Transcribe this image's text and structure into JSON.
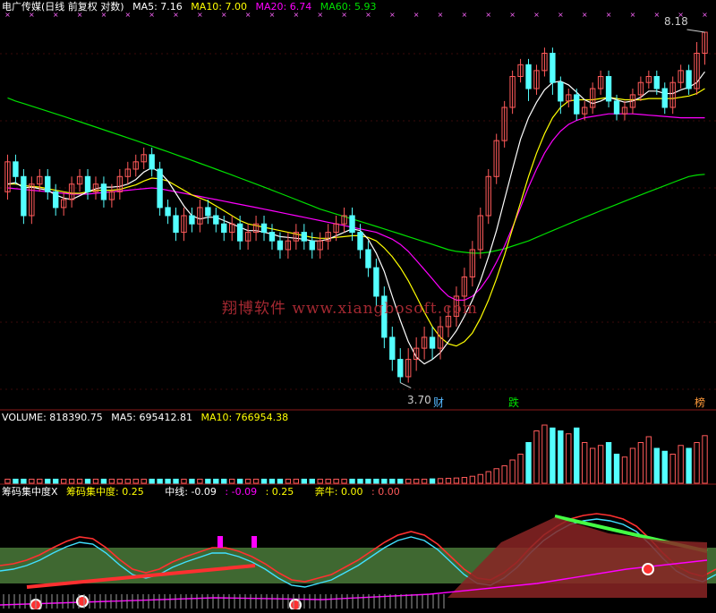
{
  "price_header": {
    "title": "电广传媒(日线 前复权 对数)",
    "ma5": "MA5: 7.16",
    "ma10": "MA10: 7.00",
    "ma20": "MA20: 6.74",
    "ma60": "MA60: 5.93"
  },
  "volume_header": {
    "title": "VOLUME: 818390.75",
    "ma5": "MA5: 695412.81",
    "ma10": "MA10: 766954.38"
  },
  "indicator_header": {
    "name": "筹码集中度X",
    "value": "筹码集中度: 0.25",
    "mid_label": "中线: -0.09",
    "mid_v2": ": -0.09",
    "mid_v3": ": 0.25",
    "bull": "奔牛: 0.00",
    "bull_v2": ": 0.00"
  },
  "watermark": "翔博软件 www.xiangbosoft.com",
  "price_marks": {
    "high": "8.18",
    "low": "3.70"
  },
  "event_labels": {
    "cai": "财",
    "die": "跌",
    "bang": "榜"
  },
  "colors": {
    "up": "#ff5a5a",
    "down": "#54ffff",
    "ma5": "#ffffff",
    "ma10": "#ffff00",
    "ma20": "#ff00ff",
    "ma60": "#00e000",
    "green_area": "#4a7a3a",
    "dark_red_area": "#8a2525"
  },
  "chart_data": [
    {
      "type": "candlestick",
      "title": "电广传媒(日线 前复权 对数)",
      "ylim": [
        3.55,
        8.45
      ],
      "log_scale": true,
      "annotated_high": 8.18,
      "annotated_low": 3.7,
      "candles": [
        [
          5.7,
          6.1,
          6.2,
          5.6
        ],
        [
          6.1,
          5.9,
          6.2,
          5.8
        ],
        [
          5.9,
          5.4,
          6.0,
          5.3
        ],
        [
          5.4,
          5.8,
          5.9,
          5.3
        ],
        [
          5.8,
          5.9,
          6.0,
          5.7
        ],
        [
          5.9,
          5.7,
          6.0,
          5.6
        ],
        [
          5.7,
          5.5,
          5.8,
          5.4
        ],
        [
          5.5,
          5.6,
          5.7,
          5.4
        ],
        [
          5.6,
          5.8,
          5.9,
          5.5
        ],
        [
          5.8,
          5.9,
          6.0,
          5.7
        ],
        [
          5.9,
          5.7,
          6.0,
          5.6
        ],
        [
          5.7,
          5.8,
          5.9,
          5.6
        ],
        [
          5.8,
          5.6,
          5.9,
          5.5
        ],
        [
          5.6,
          5.7,
          5.8,
          5.5
        ],
        [
          5.7,
          5.9,
          6.0,
          5.6
        ],
        [
          5.9,
          6.0,
          6.1,
          5.8
        ],
        [
          6.0,
          6.1,
          6.2,
          5.9
        ],
        [
          6.1,
          6.2,
          6.3,
          6.0
        ],
        [
          6.2,
          6.0,
          6.3,
          5.9
        ],
        [
          6.0,
          5.5,
          6.1,
          5.4
        ],
        [
          5.5,
          5.4,
          5.6,
          5.3
        ],
        [
          5.4,
          5.2,
          5.5,
          5.1
        ],
        [
          5.2,
          5.4,
          5.5,
          5.1
        ],
        [
          5.4,
          5.3,
          5.5,
          5.2
        ],
        [
          5.3,
          5.5,
          5.6,
          5.2
        ],
        [
          5.5,
          5.4,
          5.6,
          5.3
        ],
        [
          5.4,
          5.3,
          5.5,
          5.2
        ],
        [
          5.3,
          5.2,
          5.4,
          5.1
        ],
        [
          5.2,
          5.3,
          5.4,
          5.1
        ],
        [
          5.3,
          5.1,
          5.4,
          5.0
        ],
        [
          5.1,
          5.2,
          5.3,
          5.0
        ],
        [
          5.2,
          5.3,
          5.4,
          5.1
        ],
        [
          5.3,
          5.2,
          5.4,
          5.1
        ],
        [
          5.2,
          5.1,
          5.3,
          5.0
        ],
        [
          5.1,
          5.0,
          5.2,
          4.9
        ],
        [
          5.0,
          5.1,
          5.2,
          4.9
        ],
        [
          5.1,
          5.2,
          5.3,
          5.0
        ],
        [
          5.2,
          5.1,
          5.3,
          5.0
        ],
        [
          5.1,
          5.0,
          5.2,
          4.9
        ],
        [
          5.0,
          5.1,
          5.2,
          4.9
        ],
        [
          5.1,
          5.2,
          5.3,
          5.0
        ],
        [
          5.2,
          5.3,
          5.4,
          5.1
        ],
        [
          5.3,
          5.4,
          5.5,
          5.2
        ],
        [
          5.4,
          5.2,
          5.5,
          5.1
        ],
        [
          5.2,
          5.0,
          5.3,
          4.9
        ],
        [
          5.0,
          4.8,
          5.1,
          4.7
        ],
        [
          4.8,
          4.5,
          4.9,
          4.4
        ],
        [
          4.5,
          4.1,
          4.6,
          4.0
        ],
        [
          4.1,
          3.9,
          4.2,
          3.8
        ],
        [
          3.9,
          3.75,
          4.0,
          3.7
        ],
        [
          3.75,
          3.9,
          4.0,
          3.7
        ],
        [
          3.9,
          4.0,
          4.1,
          3.8
        ],
        [
          4.0,
          4.1,
          4.2,
          3.9
        ],
        [
          4.1,
          4.0,
          4.2,
          3.9
        ],
        [
          4.0,
          4.2,
          4.3,
          3.9
        ],
        [
          4.2,
          4.3,
          4.4,
          4.1
        ],
        [
          4.3,
          4.5,
          4.6,
          4.2
        ],
        [
          4.5,
          4.7,
          4.8,
          4.4
        ],
        [
          4.7,
          5.0,
          5.1,
          4.6
        ],
        [
          5.0,
          5.4,
          5.5,
          4.9
        ],
        [
          5.4,
          5.9,
          6.0,
          5.3
        ],
        [
          5.9,
          6.4,
          6.5,
          5.8
        ],
        [
          6.4,
          6.9,
          7.0,
          6.3
        ],
        [
          6.9,
          7.4,
          7.5,
          6.8
        ],
        [
          7.4,
          7.6,
          7.7,
          7.3
        ],
        [
          7.6,
          7.2,
          7.7,
          7.0
        ],
        [
          7.2,
          7.5,
          7.6,
          7.1
        ],
        [
          7.5,
          7.8,
          7.9,
          7.4
        ],
        [
          7.8,
          7.3,
          7.9,
          7.1
        ],
        [
          7.3,
          7.0,
          7.4,
          6.8
        ],
        [
          7.0,
          7.1,
          7.2,
          6.9
        ],
        [
          7.1,
          6.8,
          7.2,
          6.7
        ],
        [
          6.8,
          6.9,
          7.0,
          6.7
        ],
        [
          6.9,
          7.2,
          7.3,
          6.8
        ],
        [
          7.2,
          7.4,
          7.5,
          7.1
        ],
        [
          7.4,
          7.0,
          7.5,
          6.9
        ],
        [
          7.0,
          6.8,
          7.1,
          6.7
        ],
        [
          6.8,
          6.9,
          7.0,
          6.7
        ],
        [
          6.9,
          7.1,
          7.2,
          6.8
        ],
        [
          7.1,
          7.3,
          7.4,
          7.0
        ],
        [
          7.3,
          7.4,
          7.5,
          7.2
        ],
        [
          7.4,
          7.2,
          7.5,
          7.1
        ],
        [
          7.2,
          6.9,
          7.3,
          6.8
        ],
        [
          6.9,
          7.3,
          7.4,
          6.8
        ],
        [
          7.3,
          7.5,
          7.6,
          7.2
        ],
        [
          7.5,
          7.2,
          7.6,
          7.1
        ],
        [
          7.2,
          7.8,
          8.0,
          7.1
        ],
        [
          7.8,
          8.18,
          8.18,
          7.6
        ]
      ],
      "ma5": [
        5.8,
        5.82,
        5.75,
        5.76,
        5.74,
        5.72,
        5.66,
        5.62,
        5.6,
        5.65,
        5.7,
        5.74,
        5.76,
        5.76,
        5.77,
        5.8,
        5.86,
        5.96,
        6.02,
        5.96,
        5.84,
        5.68,
        5.52,
        5.4,
        5.36,
        5.38,
        5.38,
        5.34,
        5.3,
        5.26,
        5.22,
        5.22,
        5.2,
        5.18,
        5.15,
        5.14,
        5.13,
        5.12,
        5.1,
        5.1,
        5.12,
        5.16,
        5.2,
        5.24,
        5.22,
        5.12,
        4.96,
        4.76,
        4.5,
        4.26,
        4.06,
        3.92,
        3.86,
        3.9,
        3.96,
        4.06,
        4.16,
        4.3,
        4.46,
        4.66,
        4.92,
        5.22,
        5.6,
        6.0,
        6.42,
        6.74,
        6.98,
        7.18,
        7.3,
        7.32,
        7.26,
        7.14,
        7.02,
        6.96,
        7.0,
        7.06,
        7.02,
        6.98,
        7.0,
        7.06,
        7.16,
        7.16,
        7.12,
        7.12,
        7.18,
        7.22,
        7.3,
        7.48
      ],
      "ma10": [
        5.8,
        5.8,
        5.78,
        5.77,
        5.76,
        5.74,
        5.72,
        5.7,
        5.68,
        5.68,
        5.7,
        5.72,
        5.72,
        5.72,
        5.73,
        5.76,
        5.79,
        5.84,
        5.88,
        5.87,
        5.84,
        5.78,
        5.72,
        5.66,
        5.62,
        5.58,
        5.52,
        5.46,
        5.4,
        5.34,
        5.3,
        5.28,
        5.26,
        5.24,
        5.22,
        5.2,
        5.18,
        5.16,
        5.14,
        5.13,
        5.13,
        5.14,
        5.15,
        5.16,
        5.16,
        5.14,
        5.1,
        5.02,
        4.92,
        4.8,
        4.66,
        4.5,
        4.34,
        4.2,
        4.1,
        4.04,
        4.02,
        4.06,
        4.14,
        4.28,
        4.46,
        4.68,
        4.94,
        5.24,
        5.56,
        5.9,
        6.22,
        6.5,
        6.74,
        6.9,
        7.0,
        7.02,
        7.02,
        7.02,
        7.04,
        7.06,
        7.04,
        7.02,
        7.02,
        7.02,
        7.04,
        7.04,
        7.04,
        7.04,
        7.06,
        7.08,
        7.12,
        7.2
      ],
      "ma20": [
        5.75,
        5.74,
        5.73,
        5.72,
        5.71,
        5.7,
        5.69,
        5.68,
        5.67,
        5.67,
        5.67,
        5.68,
        5.69,
        5.7,
        5.71,
        5.72,
        5.73,
        5.74,
        5.75,
        5.74,
        5.72,
        5.7,
        5.68,
        5.66,
        5.64,
        5.62,
        5.6,
        5.58,
        5.56,
        5.54,
        5.52,
        5.5,
        5.48,
        5.46,
        5.44,
        5.42,
        5.4,
        5.38,
        5.36,
        5.34,
        5.32,
        5.3,
        5.28,
        5.26,
        5.24,
        5.22,
        5.2,
        5.16,
        5.12,
        5.06,
        4.98,
        4.88,
        4.78,
        4.68,
        4.58,
        4.5,
        4.46,
        4.46,
        4.5,
        4.58,
        4.7,
        4.86,
        5.04,
        5.26,
        5.5,
        5.76,
        6.0,
        6.22,
        6.4,
        6.54,
        6.64,
        6.7,
        6.74,
        6.76,
        6.78,
        6.8,
        6.8,
        6.8,
        6.8,
        6.79,
        6.78,
        6.77,
        6.76,
        6.75,
        6.74,
        6.74,
        6.74,
        6.74
      ],
      "ma60": [
        7.05,
        7.0,
        6.96,
        6.92,
        6.88,
        6.84,
        6.8,
        6.76,
        6.72,
        6.68,
        6.64,
        6.6,
        6.56,
        6.52,
        6.48,
        6.44,
        6.4,
        6.36,
        6.32,
        6.28,
        6.24,
        6.2,
        6.16,
        6.12,
        6.08,
        6.04,
        6.0,
        5.96,
        5.92,
        5.88,
        5.84,
        5.8,
        5.76,
        5.72,
        5.68,
        5.64,
        5.6,
        5.56,
        5.52,
        5.48,
        5.45,
        5.42,
        5.39,
        5.36,
        5.33,
        5.3,
        5.27,
        5.24,
        5.21,
        5.18,
        5.15,
        5.12,
        5.09,
        5.06,
        5.03,
        5.0,
        4.98,
        4.97,
        4.96,
        4.96,
        4.97,
        4.99,
        5.01,
        5.04,
        5.07,
        5.1,
        5.14,
        5.18,
        5.22,
        5.26,
        5.3,
        5.34,
        5.38,
        5.42,
        5.46,
        5.5,
        5.54,
        5.58,
        5.62,
        5.66,
        5.7,
        5.74,
        5.78,
        5.82,
        5.86,
        5.9,
        5.92,
        5.93
      ]
    },
    {
      "type": "bar",
      "title": "VOLUME",
      "values": [
        70000,
        70000,
        70000,
        70000,
        70000,
        70000,
        70000,
        70000,
        70000,
        70000,
        70000,
        70000,
        70000,
        70000,
        70000,
        70000,
        70000,
        70000,
        70000,
        70000,
        70000,
        70000,
        70000,
        70000,
        70000,
        70000,
        70000,
        70000,
        70000,
        70000,
        70000,
        70000,
        70000,
        70000,
        70000,
        70000,
        70000,
        70000,
        70000,
        70000,
        70000,
        70000,
        70000,
        70000,
        70000,
        70000,
        70000,
        70000,
        70000,
        70000,
        70000,
        70000,
        70000,
        75000,
        80000,
        85000,
        90000,
        100000,
        120000,
        150000,
        200000,
        250000,
        300000,
        400000,
        500000,
        700000,
        900000,
        1000000,
        950000,
        900000,
        850000,
        950000,
        700000,
        600000,
        650000,
        700000,
        500000,
        450000,
        600000,
        700000,
        800000,
        600000,
        550000,
        500000,
        650000,
        600000,
        700000,
        818390
      ],
      "ma5": 695412.81,
      "ma10": 766954.38
    },
    {
      "type": "line",
      "title": "筹码集中度X",
      "value": 0.25,
      "mid_line": -0.09,
      "bull": 0.0
    }
  ]
}
